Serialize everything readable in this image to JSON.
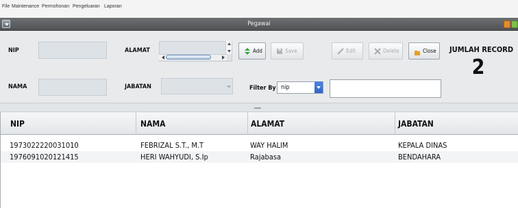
{
  "menu": [
    "File",
    "Maintenance",
    "Permohonan",
    "Pengeluaran",
    "Laporan"
  ],
  "window": {
    "title": "Pegawai"
  },
  "form": {
    "nip_label": "NIP",
    "nama_label": "NAMA",
    "alamat_label": "ALAMAT",
    "jabatan_label": "JABATAN",
    "filter_label": "Filter By",
    "filter_value": "nip",
    "search_value": "",
    "nip_value": "",
    "nama_value": "",
    "jabatan_value": ""
  },
  "toolbar": {
    "add": "Add",
    "save": "Save",
    "edit": "Edit",
    "delete": "Delete",
    "close": "Close"
  },
  "jumlah": {
    "title": "JUMLAH RECORD",
    "value": "2"
  },
  "table": {
    "columns": [
      "NIP",
      "NAMA",
      "ALAMAT",
      "JABATAN"
    ],
    "rows": [
      [
        "1973022220031010",
        "FEBRIZAL S.T., M.T",
        "WAY HALIM",
        "KEPALA DINAS"
      ],
      [
        "1976091020121415",
        "HERI WAHYUDI, S.Ip",
        "Rajabasa",
        "BENDAHARA"
      ]
    ]
  },
  "colors": {
    "add_icon": "#3aa33a",
    "close_icon": "#e2a020",
    "select_accent": "#2f64c8"
  }
}
